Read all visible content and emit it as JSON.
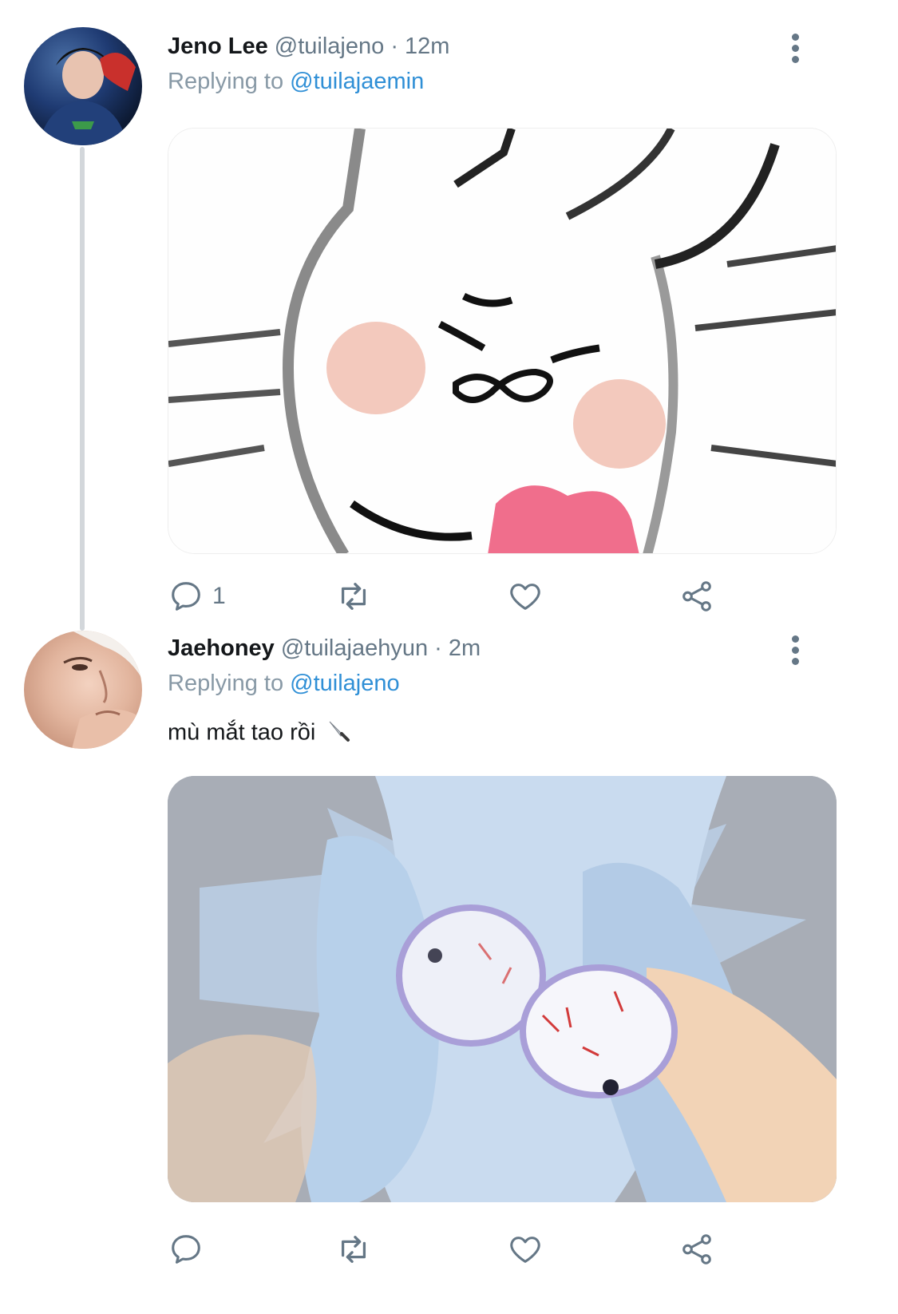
{
  "tweets": [
    {
      "name": "Jeno Lee",
      "handle": "@tuilajeno",
      "separator": "·",
      "time": "12m",
      "replying_prefix": "Replying to",
      "replying_to": "@tuilajaemin",
      "text": "",
      "reply_count": "1",
      "avatar_icon": "profile-photo",
      "media_icon": "bunny-sticker-image"
    },
    {
      "name": "Jaehoney",
      "handle": "@tuilajaehyun",
      "separator": "·",
      "time": "2m",
      "replying_prefix": "Replying to",
      "replying_to": "@tuilajeno",
      "text": "mù mắt tao rồi",
      "emoji": "knife",
      "reply_count": "",
      "avatar_icon": "profile-photo",
      "media_icon": "hands-holding-eyeballs-image"
    }
  ],
  "colors": {
    "mention": "#2f8fd6",
    "secondary_text": "#657786",
    "thread_line": "#d3d7db"
  }
}
